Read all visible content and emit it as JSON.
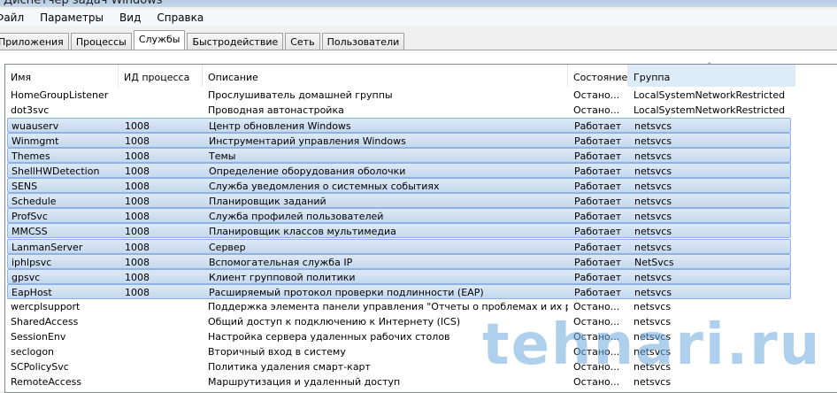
{
  "window": {
    "title": "Диспетчер задач Windows"
  },
  "menu": [
    "Файл",
    "Параметры",
    "Вид",
    "Справка"
  ],
  "tabs": [
    "Приложения",
    "Процессы",
    "Службы",
    "Быстродействие",
    "Сеть",
    "Пользователи"
  ],
  "active_tab": "Службы",
  "columns": [
    "Имя",
    "ИД процесса",
    "Описание",
    "Состояние",
    "Группа"
  ],
  "rows": [
    [
      "HomeGroupListener",
      "",
      "Прослушиватель домашней группы",
      "Остано...",
      "LocalSystemNetworkRestricted"
    ],
    [
      "dot3svc",
      "",
      "Проводная автонастройка",
      "Остано...",
      "LocalSystemNetworkRestricted"
    ],
    [
      "wuauserv",
      "1008",
      "Центр обновления Windows",
      "Работает",
      "netsvcs"
    ],
    [
      "Winmgmt",
      "1008",
      "Инструментарий управления Windows",
      "Работает",
      "netsvcs"
    ],
    [
      "Themes",
      "1008",
      "Темы",
      "Работает",
      "netsvcs"
    ],
    [
      "ShellHWDetection",
      "1008",
      "Определение оборудования оболочки",
      "Работает",
      "netsvcs"
    ],
    [
      "SENS",
      "1008",
      "Служба уведомления о системных событиях",
      "Работает",
      "netsvcs"
    ],
    [
      "Schedule",
      "1008",
      "Планировщик заданий",
      "Работает",
      "netsvcs"
    ],
    [
      "ProfSvc",
      "1008",
      "Служба профилей пользователей",
      "Работает",
      "netsvcs"
    ],
    [
      "MMCSS",
      "1008",
      "Планировщик классов мультимедиа",
      "Работает",
      "netsvcs"
    ],
    [
      "LanmanServer",
      "1008",
      "Сервер",
      "Работает",
      "netsvcs"
    ],
    [
      "iphlpsvc",
      "1008",
      "Вспомогательная служба IP",
      "Работает",
      "NetSvcs"
    ],
    [
      "gpsvc",
      "1008",
      "Клиент групповой политики",
      "Работает",
      "netsvcs"
    ],
    [
      "EapHost",
      "1008",
      "Расширяемый протокол проверки подлинности (EAP)",
      "Работает",
      "netsvcs"
    ],
    [
      "wercplsupport",
      "",
      "Поддержка элемента панели управления \"Отчеты о проблемах и их решен...",
      "Остано...",
      "netsvcs"
    ],
    [
      "SharedAccess",
      "",
      "Общий доступ к подключению к Интернету (ICS)",
      "Остано...",
      "netsvcs"
    ],
    [
      "SessionEnv",
      "",
      "Настройка сервера удаленных рабочих столов",
      "Остано...",
      "netsvcs"
    ],
    [
      "seclogon",
      "",
      "Вторичный вход в систему",
      "Остано...",
      "netsvcs"
    ],
    [
      "SCPolicySvc",
      "",
      "Политика удаления смарт-карт",
      "Остано...",
      "netsvcs"
    ],
    [
      "RemoteAccess",
      "",
      "Маршрутизация и удаленный доступ",
      "Остано...",
      "netsvcs"
    ]
  ],
  "highlighted_rows": [
    2,
    3,
    4,
    5,
    6,
    7,
    8,
    9,
    10,
    11,
    12,
    13
  ],
  "watermark": "tehnari.ru"
}
